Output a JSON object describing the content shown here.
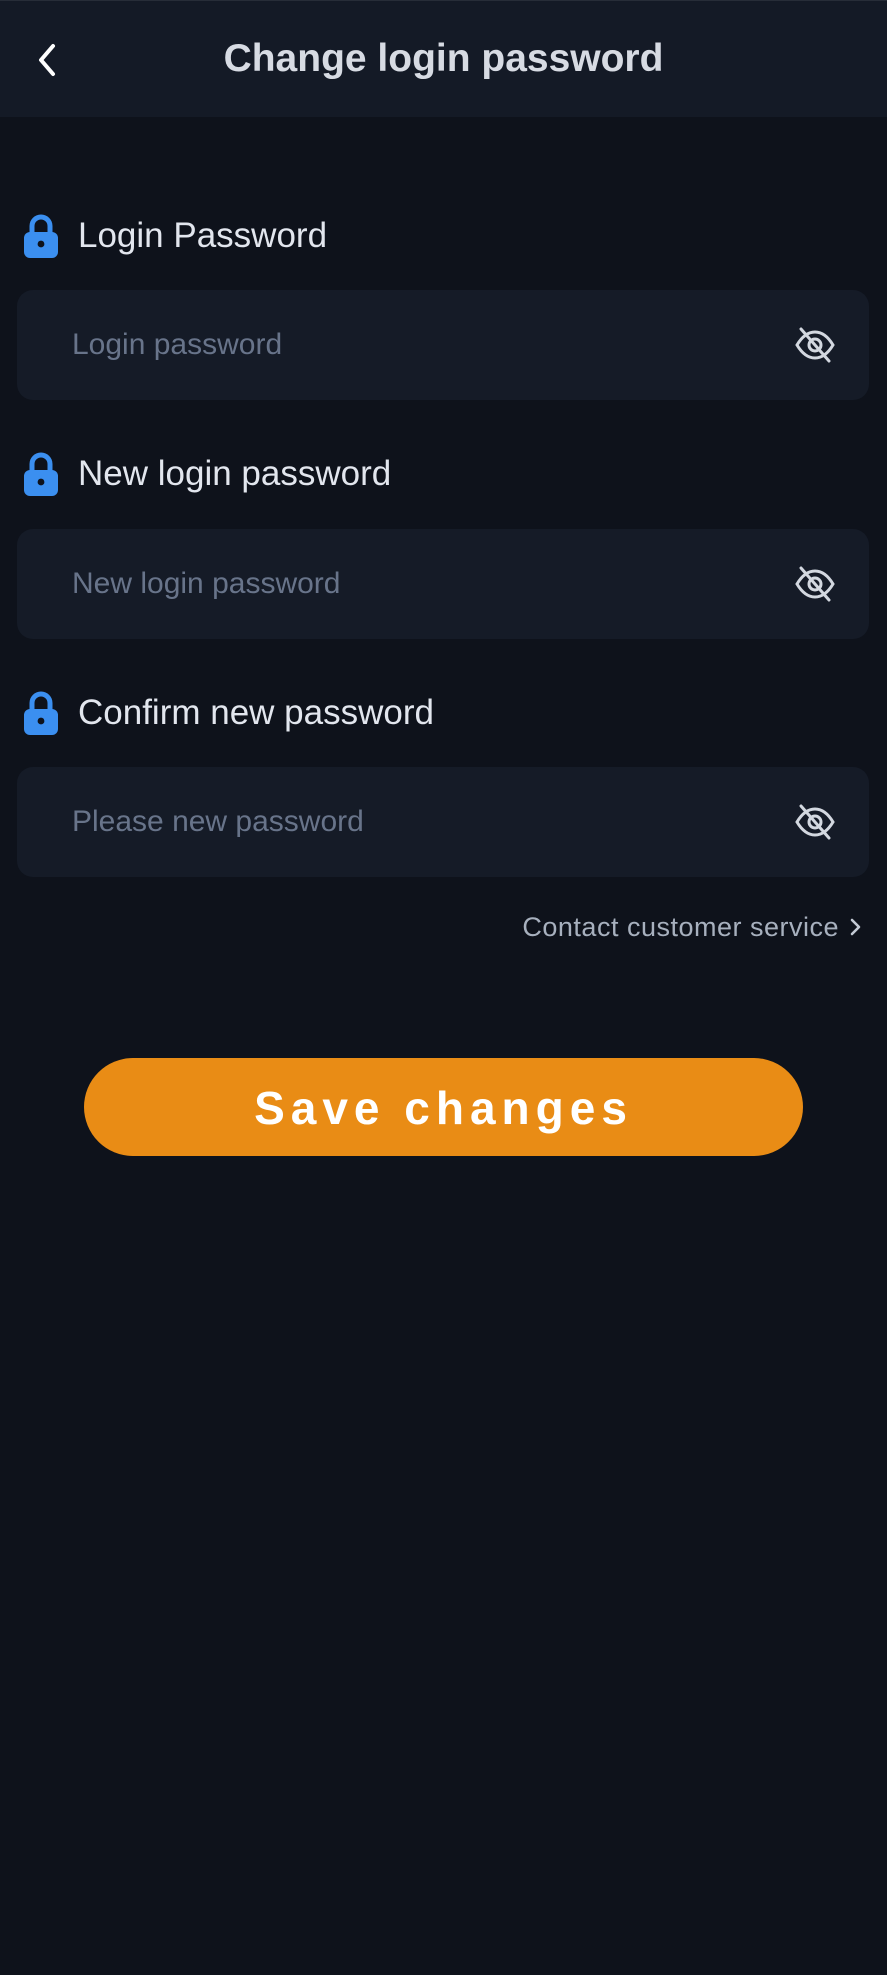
{
  "header": {
    "title": "Change login password",
    "back_icon": "chevron-left-icon"
  },
  "fields": [
    {
      "label": "Login Password",
      "placeholder": "Login password",
      "value": "",
      "icon": "lock-icon",
      "toggle_icon": "eye-off-icon"
    },
    {
      "label": "New login password",
      "placeholder": "New login password",
      "value": "",
      "icon": "lock-icon",
      "toggle_icon": "eye-off-icon"
    },
    {
      "label": "Confirm new password",
      "placeholder": "Please new password",
      "value": "",
      "icon": "lock-icon",
      "toggle_icon": "eye-off-icon"
    }
  ],
  "contact": {
    "label": "Contact customer service",
    "icon": "chevron-right-icon"
  },
  "save_button": {
    "label": "Save changes"
  },
  "colors": {
    "background": "#0e121b",
    "header": "#141a26",
    "input": "#151b27",
    "accent_lock": "#3b8ff0",
    "button": "#e98c15"
  }
}
